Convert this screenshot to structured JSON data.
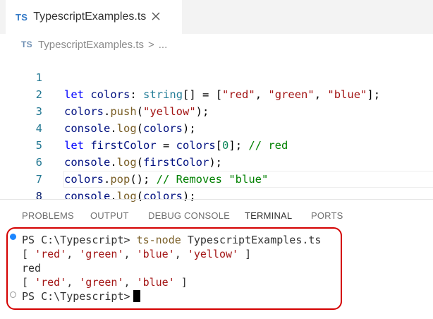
{
  "tab": {
    "badge": "TS",
    "filename": "TypescriptExamples.ts"
  },
  "breadcrumb": {
    "badge": "TS",
    "file": "TypescriptExamples.ts",
    "separator": ">",
    "more": "..."
  },
  "editor": {
    "lines": [
      {
        "num": "1"
      },
      {
        "num": "2"
      },
      {
        "num": "3"
      },
      {
        "num": "4"
      },
      {
        "num": "5"
      },
      {
        "num": "6"
      },
      {
        "num": "7"
      },
      {
        "num": "8"
      }
    ],
    "tokens": {
      "l1": [
        "let",
        "colors",
        ":",
        "string",
        "[] = [",
        "\"red\"",
        ", ",
        "\"green\"",
        ", ",
        "\"blue\"",
        "];"
      ],
      "l2": [
        "colors",
        ".",
        "push",
        "(",
        "\"yellow\"",
        ");"
      ],
      "l3": [
        "console",
        ".",
        "log",
        "(",
        "colors",
        ");"
      ],
      "l4": [
        "let",
        "firstColor",
        " = ",
        "colors",
        "[",
        "0",
        "]; ",
        "// red"
      ],
      "l5": [
        "console",
        ".",
        "log",
        "(",
        "firstColor",
        ");"
      ],
      "l6": [
        "colors",
        ".",
        "pop",
        "(); ",
        "// Removes \"blue\""
      ],
      "l7": [
        "console",
        ".",
        "log",
        "(",
        "colors",
        ");"
      ]
    }
  },
  "panel": {
    "tabs": [
      "PROBLEMS",
      "OUTPUT",
      "DEBUG CONSOLE",
      "TERMINAL",
      "PORTS"
    ],
    "active_tab": "TERMINAL"
  },
  "terminal": {
    "prompt": "PS C:\\Typescript>",
    "command": "ts-node",
    "command_arg": "TypescriptExamples.ts",
    "out1": [
      "[ ",
      "'red'",
      ", ",
      "'green'",
      ", ",
      "'blue'",
      ", ",
      "'yellow'",
      " ]"
    ],
    "out2": "red",
    "out3": [
      "[ ",
      "'red'",
      ", ",
      "'green'",
      ", ",
      "'blue'",
      " ]"
    ],
    "prompt2": "PS C:\\Typescript>"
  },
  "colors": {
    "highlight_border": "#d40000",
    "ts_badge": "#3178c6",
    "status_dot": "#1a85ff"
  }
}
